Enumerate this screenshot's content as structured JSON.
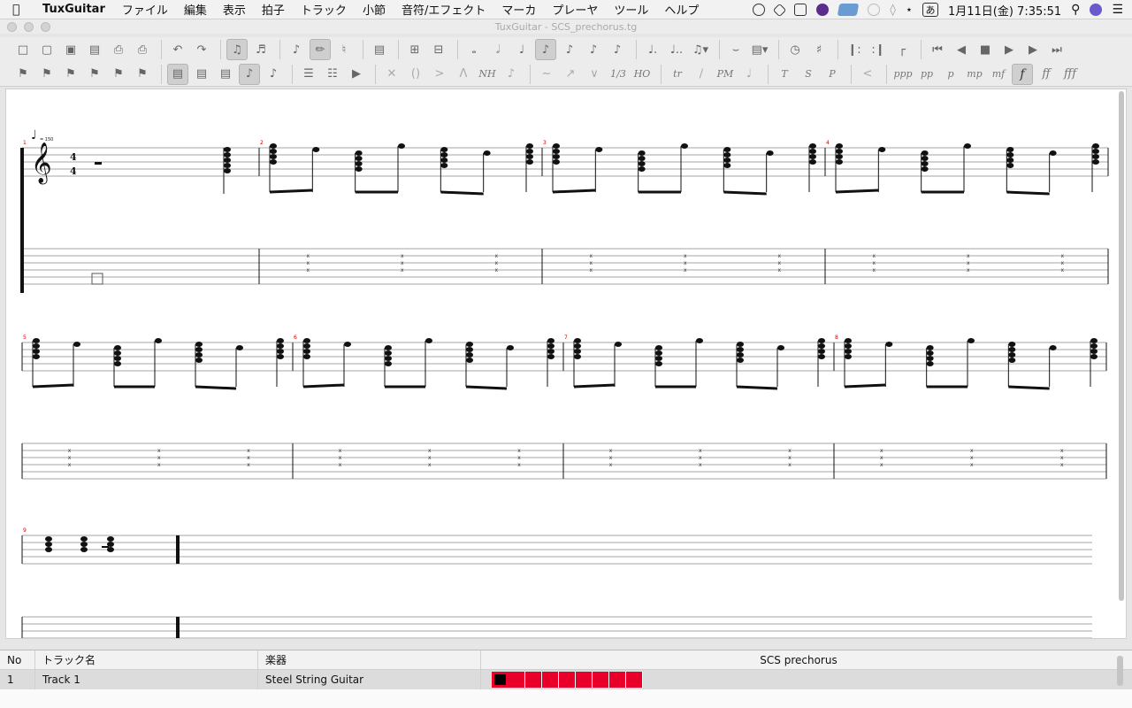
{
  "menubar": {
    "app": "TuxGuitar",
    "items": [
      "ファイル",
      "編集",
      "表示",
      "拍子",
      "トラック",
      "小節",
      "音符/エフェクト",
      "マーカ",
      "プレーヤ",
      "ツール",
      "ヘルプ"
    ],
    "input_method": "あ",
    "clock": "1月11日(金)  7:35:51"
  },
  "window": {
    "title": "TuxGuitar - SCS_prechorus.tg"
  },
  "toolbar": {
    "dynamics": [
      "ppp",
      "pp",
      "p",
      "mp",
      "mf",
      "f",
      "ff",
      "fff"
    ],
    "effects": [
      "tr",
      "PM",
      "T",
      "S",
      "P",
      "1/3",
      "HO",
      "NH"
    ]
  },
  "score": {
    "tempo": "= 150",
    "time_sig": {
      "num": "4",
      "den": "4"
    },
    "bar_numbers": [
      "1",
      "2",
      "3",
      "4",
      "5",
      "6",
      "7",
      "8",
      "9"
    ]
  },
  "tracks": {
    "headers": {
      "no": "No",
      "name": "トラック名",
      "instrument": "楽器",
      "song": "SCS prechorus"
    },
    "rows": [
      {
        "no": "1",
        "name": "Track 1",
        "instrument": "Steel String Guitar",
        "measures": 9
      }
    ]
  }
}
